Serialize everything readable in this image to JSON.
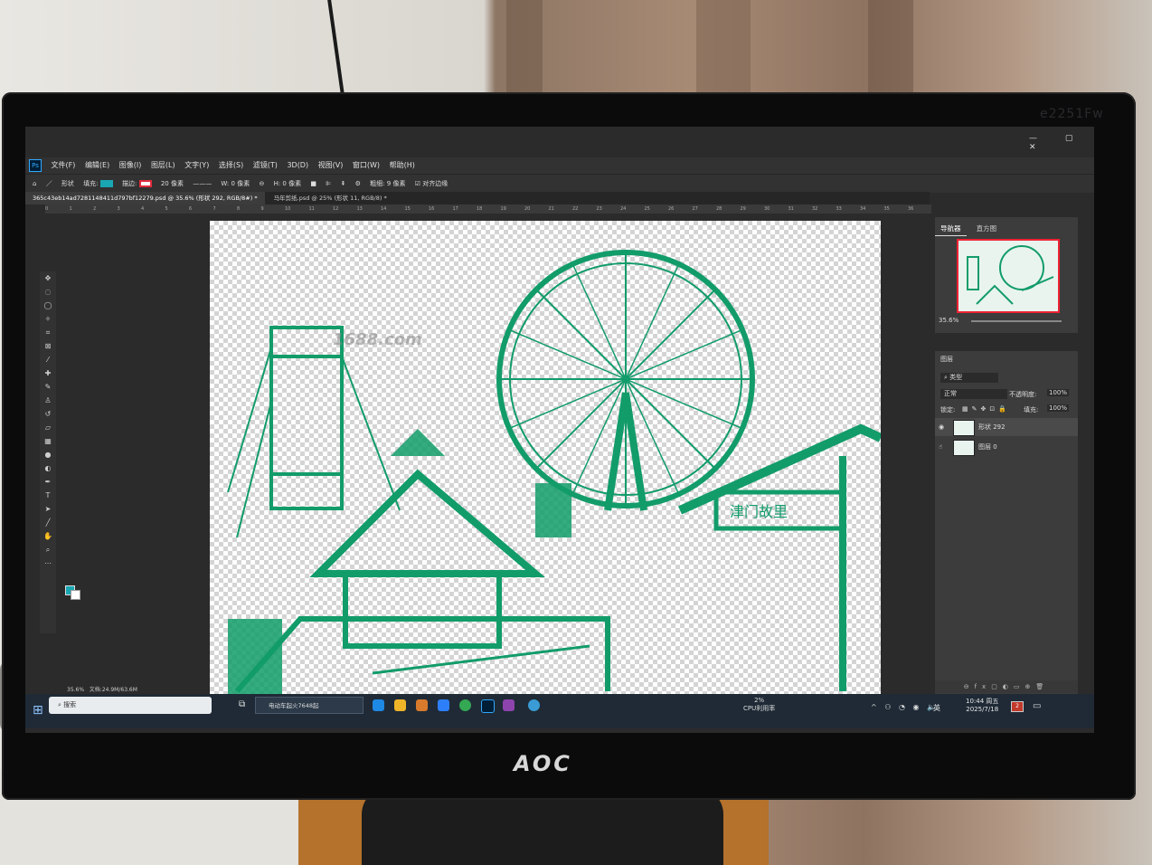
{
  "monitor": {
    "model": "e2251Fw",
    "logo": "AOC"
  },
  "menubar": {
    "items": [
      "文件(F)",
      "编辑(E)",
      "图像(I)",
      "图层(L)",
      "文字(Y)",
      "选择(S)",
      "滤镜(T)",
      "3D(D)",
      "视图(V)",
      "窗口(W)",
      "帮助(H)"
    ]
  },
  "options": {
    "shape_mode": "形状",
    "fill_label": "填充:",
    "stroke_label": "描边:",
    "stroke_size": "20 像素",
    "w_label": "W:",
    "w_value": "0 像素",
    "h_label": "H:",
    "h_value": "0 像素",
    "weight_label": "粗细:",
    "weight_value": "9 像素",
    "align_edges": "对齐边缘",
    "fill_color": "#19a7b3",
    "stroke_color": "#e02b3c"
  },
  "tabs": [
    {
      "label": "365c43eb14ad7281148411d797bf12279.psd @ 35.6% (形状 292, RGB/8#) *"
    },
    {
      "label": "马年剪纸.psd @ 25% (形状 11, RGB/8) *"
    }
  ],
  "ruler_ticks": [
    "0",
    "1",
    "2",
    "3",
    "4",
    "5",
    "6",
    "7",
    "8",
    "9",
    "10",
    "11",
    "12",
    "13",
    "14",
    "15",
    "16",
    "17",
    "18",
    "19",
    "20",
    "21",
    "22",
    "23",
    "24",
    "25",
    "26",
    "27",
    "28",
    "29",
    "30",
    "31",
    "32",
    "33",
    "34",
    "35",
    "36"
  ],
  "canvas": {
    "watermark": "1688.com",
    "sign_text": "津门故里",
    "art_color": "#129c6a"
  },
  "statusbar": {
    "zoom": "35.6%",
    "doc": "文档:24.9M/63.6M"
  },
  "navigator": {
    "tab_navigator": "导航器",
    "tab_histogram": "直方图",
    "zoom": "35.6%"
  },
  "layers": {
    "tab": "图层",
    "filter_kind": "类型",
    "blend_mode": "正常",
    "opacity_label": "不透明度:",
    "opacity_value": "100%",
    "lock_label": "锁定:",
    "fill_label": "填充:",
    "fill_value": "100%",
    "rows": [
      {
        "name": "形状 292"
      },
      {
        "name": "图层 0"
      }
    ]
  },
  "taskbar": {
    "search_placeholder": "搜索",
    "edge_task": "电动车起火7648起",
    "cpu_pct": "2%",
    "cpu_label": "CPU利用率",
    "ime": "英",
    "time": "10:44 周五",
    "date": "2025/7/18",
    "notification_count": "2"
  }
}
